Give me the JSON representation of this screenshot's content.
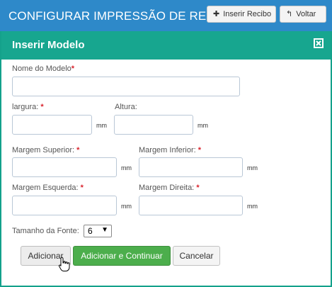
{
  "header": {
    "title": "CONFIGURAR IMPRESSÃO DE RECIBOS",
    "insert_button": "Inserir Recibo",
    "back_button": "Voltar"
  },
  "modal": {
    "title": "Inserir Modelo",
    "fields": {
      "nome_modelo": {
        "label": "Nome do Modelo",
        "required_mark": "*",
        "value": ""
      },
      "largura": {
        "label": "largura:",
        "required_mark": "*",
        "value": "",
        "unit": "mm"
      },
      "altura": {
        "label": "Altura:",
        "value": "",
        "unit": "mm"
      },
      "margem_superior": {
        "label": "Margem Superior:",
        "required_mark": "*",
        "value": "",
        "unit": "mm"
      },
      "margem_inferior": {
        "label": "Margem Inferior:",
        "required_mark": "*",
        "value": "",
        "unit": "mm"
      },
      "margem_esquerda": {
        "label": "Margem Esquerda:",
        "required_mark": "*",
        "value": "",
        "unit": "mm"
      },
      "margem_direita": {
        "label": "Margem Direita:",
        "required_mark": "*",
        "value": "",
        "unit": "mm"
      },
      "tamanho_fonte": {
        "label": "Tamanho da Fonte:",
        "selected": "6"
      }
    },
    "buttons": {
      "add": "Adicionar",
      "add_continue": "Adicionar e Continuar",
      "cancel": "Cancelar"
    }
  },
  "colors": {
    "header_blue": "#2e89c9",
    "modal_teal": "#17a68f",
    "success_green": "#4cae4c",
    "required_red": "#d9232d"
  },
  "icons": [
    "plus-icon",
    "undo-arrow-icon",
    "close-icon",
    "hand-pointer-cursor-icon"
  ]
}
